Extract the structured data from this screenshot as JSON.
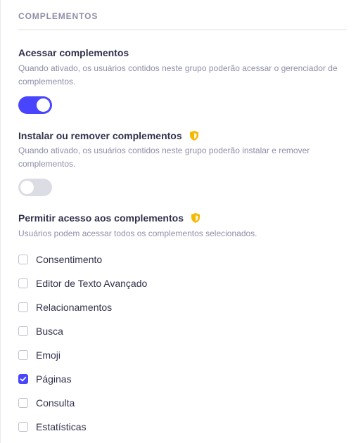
{
  "section": {
    "title": "COMPLEMENTOS"
  },
  "settings": [
    {
      "title": "Acessar complementos",
      "description": "Quando ativado, os usuários contidos neste grupo poderão acessar o gerenciador de complementos.",
      "toggle_on": true,
      "protected": false
    },
    {
      "title": "Instalar ou remover complementos",
      "description": "Quando ativado, os usuários contidos neste grupo poderão instalar e remover complementos.",
      "toggle_on": false,
      "protected": true
    }
  ],
  "access": {
    "title": "Permitir acesso aos complementos",
    "description": "Usuários podem acessar todos os complementos selecionados.",
    "protected": true,
    "options": [
      {
        "label": "Consentimento",
        "checked": false
      },
      {
        "label": "Editor de Texto Avançado",
        "checked": false
      },
      {
        "label": "Relacionamentos",
        "checked": false
      },
      {
        "label": "Busca",
        "checked": false
      },
      {
        "label": "Emoji",
        "checked": false
      },
      {
        "label": "Páginas",
        "checked": true
      },
      {
        "label": "Consulta",
        "checked": false
      },
      {
        "label": "Estatísticas",
        "checked": false
      }
    ]
  },
  "colors": {
    "accent": "#4945ff",
    "shield": "#f5b800",
    "muted_text": "#8e8ea9",
    "text": "#32324d"
  },
  "icons": {
    "protected": "shield-icon",
    "checked": "checkmark-icon"
  }
}
